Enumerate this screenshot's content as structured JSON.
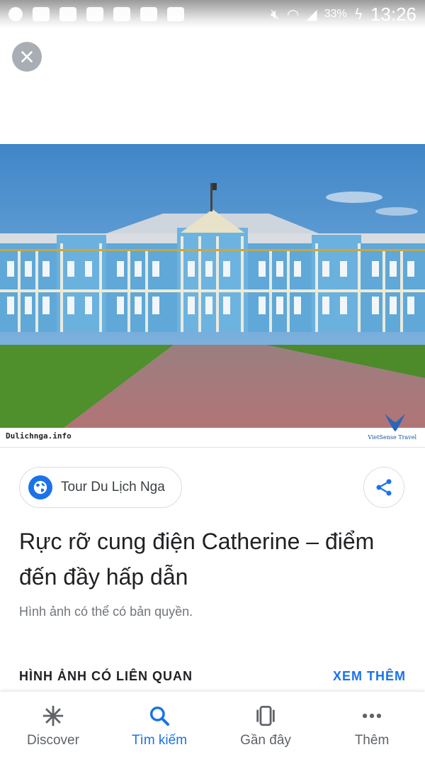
{
  "status_bar": {
    "battery": "33%",
    "time": "13:26"
  },
  "image": {
    "watermark_left": "Dulichnga.info",
    "watermark_right": "VietSense Travel"
  },
  "source": {
    "label": "Tour Du Lịch Nga",
    "icon": "globe-icon"
  },
  "result": {
    "title": "Rực rỡ cung điện Catherine – điểm đến đầy hấp dẫn",
    "copyright_note": "Hình ảnh có thể có bản quyền."
  },
  "related": {
    "heading": "HÌNH ẢNH CÓ LIÊN QUAN",
    "see_more": "XEM THÊM"
  },
  "bottom_nav": {
    "items": [
      {
        "label": "Discover",
        "icon": "asterisk-icon"
      },
      {
        "label": "Tìm kiếm",
        "icon": "search-icon",
        "active": true
      },
      {
        "label": "Gần đây",
        "icon": "recent-cards-icon"
      },
      {
        "label": "Thêm",
        "icon": "more-dots-icon"
      }
    ]
  },
  "colors": {
    "accent": "#1a73e8",
    "text_primary": "#202124",
    "text_secondary": "#70757a"
  }
}
